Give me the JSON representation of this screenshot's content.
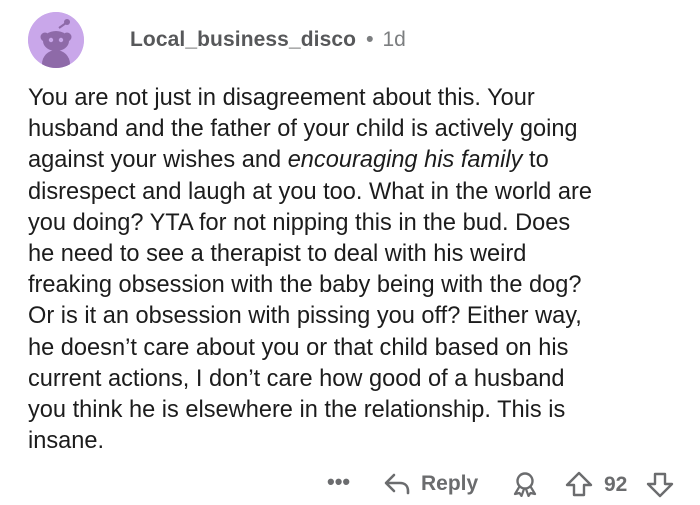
{
  "comment": {
    "username": "Local_business_disco",
    "separator": "•",
    "age": "1d",
    "body_lines": [
      {
        "pre": "You are not just in disagreement about this. Your",
        "em": "",
        "post": ""
      },
      {
        "pre": "husband and the father of your child is actively going",
        "em": "",
        "post": ""
      },
      {
        "pre": "against your wishes and ",
        "em": "encouraging his family",
        "post": " to"
      },
      {
        "pre": "disrespect and laugh at you too. What in the world are",
        "em": "",
        "post": ""
      },
      {
        "pre": "you doing? YTA for not nipping this in the bud. Does",
        "em": "",
        "post": ""
      },
      {
        "pre": "he need to see a therapist to deal with his weird",
        "em": "",
        "post": ""
      },
      {
        "pre": "freaking obsession with the baby being with the dog?",
        "em": "",
        "post": ""
      },
      {
        "pre": "Or is it an obsession with pissing you off? Either way,",
        "em": "",
        "post": ""
      },
      {
        "pre": "he doesn’t care about you or that child based on his",
        "em": "",
        "post": ""
      },
      {
        "pre": "current actions, I don’t care how good of a husband",
        "em": "",
        "post": ""
      },
      {
        "pre": "you think he is elsewhere in the relationship. This is",
        "em": "",
        "post": ""
      },
      {
        "pre": "insane.",
        "em": "",
        "post": ""
      }
    ]
  },
  "actions": {
    "more_label": "•••",
    "reply_label": "Reply",
    "score": "92"
  },
  "icons": {
    "avatar": "reddit-snoo-avatar",
    "more": "more-icon",
    "reply": "reply-arrow-icon",
    "award": "award-icon",
    "upvote": "upvote-arrow-icon",
    "downvote": "downvote-arrow-icon"
  },
  "colors": {
    "avatar_bg": "#c9a7ea",
    "meta_text": "#57585a",
    "action_gray": "#6b6c6e"
  }
}
